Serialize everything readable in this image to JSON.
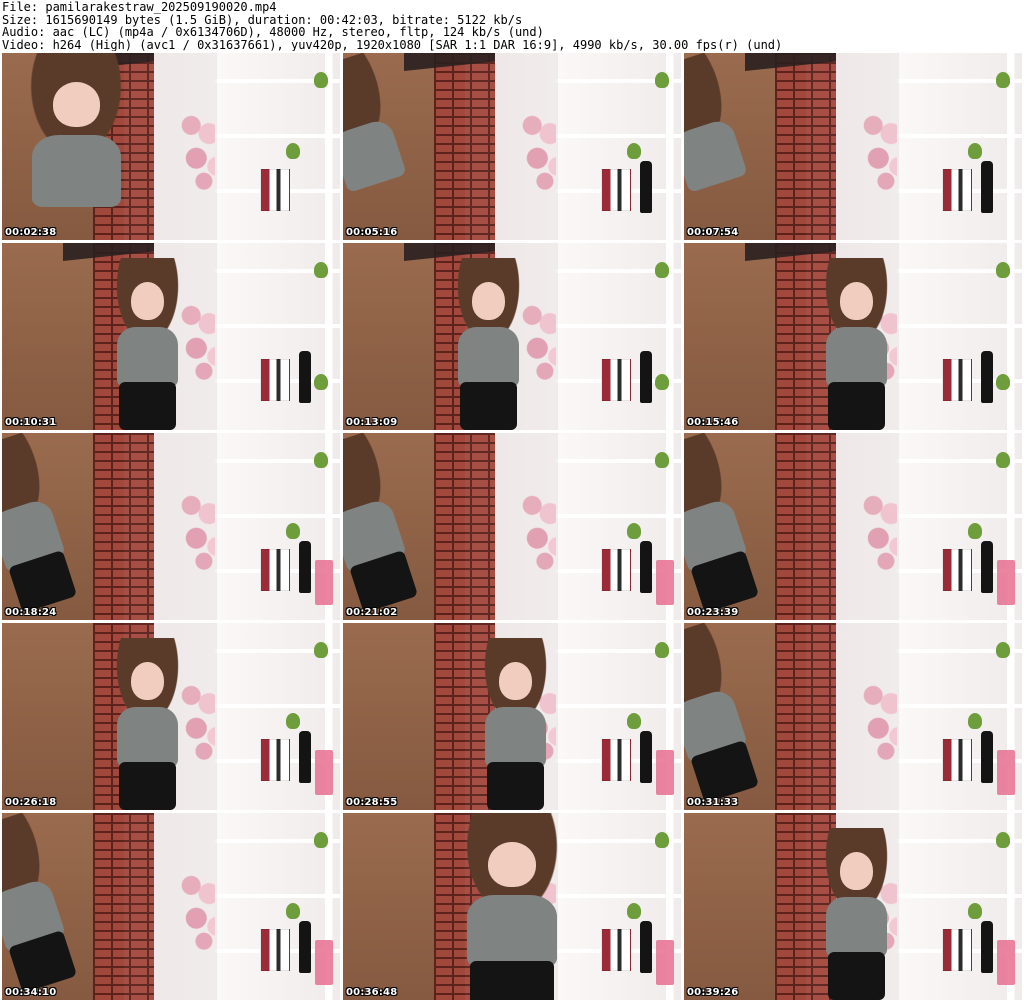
{
  "header": {
    "lines": [
      "File: pamilarakestraw_202509190020.mp4",
      "Size: 1615690149 bytes (1.5 GiB), duration: 00:42:03, bitrate: 5122 kb/s",
      "Audio: aac (LC) (mp4a / 0x6134706D), 48000 Hz, stereo, fltp, 124 kb/s (und)",
      "Video: h264 (High) (avc1 / 0x31637661), yuv420p, 1920x1080 [SAR 1:1 DAR 16:9], 4990 kb/s, 30.00 fps(r) (und)"
    ]
  },
  "thumbnails": [
    {
      "time": "00:02:38"
    },
    {
      "time": "00:05:16"
    },
    {
      "time": "00:07:54"
    },
    {
      "time": "00:10:31"
    },
    {
      "time": "00:13:09"
    },
    {
      "time": "00:15:46"
    },
    {
      "time": "00:18:24"
    },
    {
      "time": "00:21:02"
    },
    {
      "time": "00:23:39"
    },
    {
      "time": "00:26:18"
    },
    {
      "time": "00:28:55"
    },
    {
      "time": "00:31:33"
    },
    {
      "time": "00:34:10"
    },
    {
      "time": "00:36:48"
    },
    {
      "time": "00:39:26"
    }
  ]
}
